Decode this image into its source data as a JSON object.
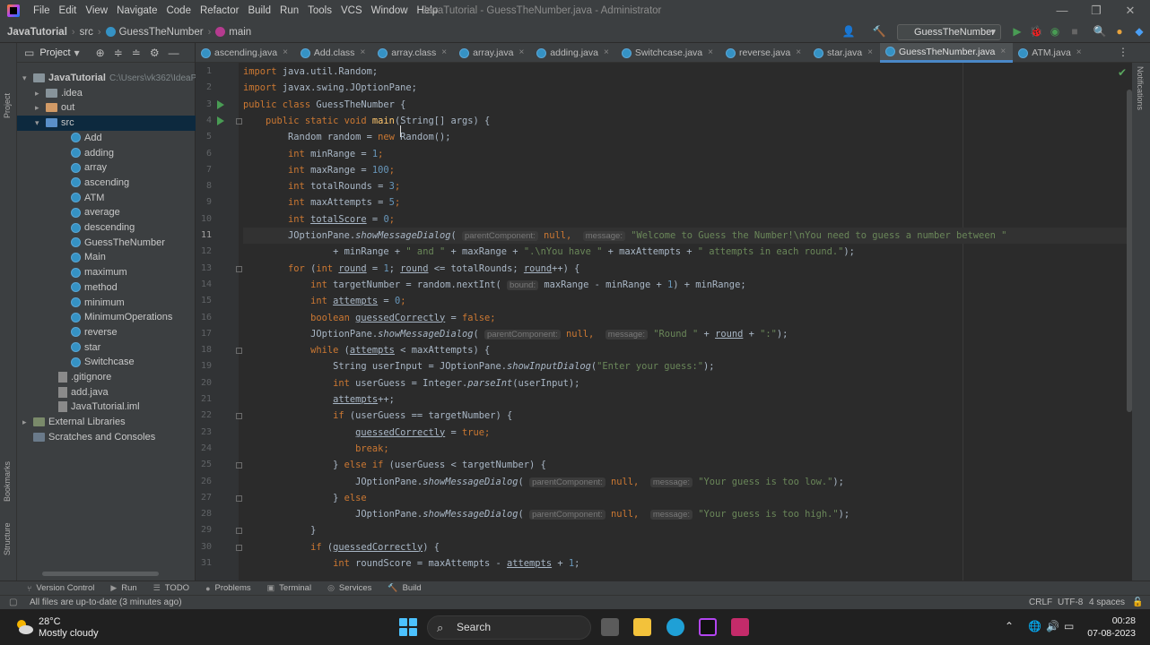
{
  "titlebar": {
    "menu": [
      "File",
      "Edit",
      "View",
      "Navigate",
      "Code",
      "Refactor",
      "Build",
      "Run",
      "Tools",
      "VCS",
      "Window",
      "Help"
    ],
    "title": "JavaTutorial - GuessTheNumber.java - Administrator"
  },
  "navbar": {
    "breadcrumb": [
      "JavaTutorial",
      "src",
      "GuessTheNumber",
      "main"
    ],
    "run_config": "GuessTheNumber"
  },
  "left_stripe": {
    "project": "Project",
    "bookmarks": "Bookmarks",
    "structure": "Structure"
  },
  "right_stripe": {
    "notifications": "Notifications"
  },
  "project_panel": {
    "title": "Project",
    "tree": [
      {
        "label": "JavaTutorial",
        "sub": "C:\\Users\\vk362\\IdeaPro",
        "indent": 0,
        "arrow": "▾",
        "icon": "folder"
      },
      {
        "label": ".idea",
        "indent": 1,
        "arrow": "▸",
        "icon": "folder"
      },
      {
        "label": "out",
        "indent": 1,
        "arrow": "▸",
        "icon": "folder-orange"
      },
      {
        "label": "src",
        "indent": 1,
        "arrow": "▾",
        "icon": "folder-blue",
        "selected": true
      },
      {
        "label": "Add",
        "indent": 3,
        "icon": "class"
      },
      {
        "label": "adding",
        "indent": 3,
        "icon": "class"
      },
      {
        "label": "array",
        "indent": 3,
        "icon": "class"
      },
      {
        "label": "ascending",
        "indent": 3,
        "icon": "class"
      },
      {
        "label": "ATM",
        "indent": 3,
        "icon": "class"
      },
      {
        "label": "average",
        "indent": 3,
        "icon": "class"
      },
      {
        "label": "descending",
        "indent": 3,
        "icon": "class"
      },
      {
        "label": "GuessTheNumber",
        "indent": 3,
        "icon": "class"
      },
      {
        "label": "Main",
        "indent": 3,
        "icon": "class"
      },
      {
        "label": "maximum",
        "indent": 3,
        "icon": "class"
      },
      {
        "label": "method",
        "indent": 3,
        "icon": "class"
      },
      {
        "label": "minimum",
        "indent": 3,
        "icon": "class"
      },
      {
        "label": "MinimumOperations",
        "indent": 3,
        "icon": "class"
      },
      {
        "label": "reverse",
        "indent": 3,
        "icon": "class"
      },
      {
        "label": "star",
        "indent": 3,
        "icon": "class"
      },
      {
        "label": "Switchcase",
        "indent": 3,
        "icon": "class"
      },
      {
        "label": ".gitignore",
        "indent": 2,
        "icon": "file"
      },
      {
        "label": "add.java",
        "indent": 2,
        "icon": "file"
      },
      {
        "label": "JavaTutorial.iml",
        "indent": 2,
        "icon": "file"
      },
      {
        "label": "External Libraries",
        "indent": 0,
        "arrow": "▸",
        "icon": "lib"
      },
      {
        "label": "Scratches and Consoles",
        "indent": 0,
        "icon": "scratch"
      }
    ]
  },
  "tabs": [
    {
      "label": "ascending.java",
      "active": false
    },
    {
      "label": "Add.class",
      "active": false
    },
    {
      "label": "array.class",
      "active": false
    },
    {
      "label": "array.java",
      "active": false
    },
    {
      "label": "adding.java",
      "active": false
    },
    {
      "label": "Switchcase.java",
      "active": false
    },
    {
      "label": "reverse.java",
      "active": false
    },
    {
      "label": "star.java",
      "active": false
    },
    {
      "label": "GuessTheNumber.java",
      "active": true
    },
    {
      "label": "ATM.java",
      "active": false
    }
  ],
  "editor": {
    "current_line": 11,
    "lines": [
      "1",
      "2",
      "3",
      "4",
      "5",
      "6",
      "7",
      "8",
      "9",
      "10",
      "11",
      "12",
      "13",
      "14",
      "15",
      "16",
      "17",
      "18",
      "19",
      "20",
      "21",
      "22",
      "23",
      "24",
      "25",
      "26",
      "27",
      "28",
      "29",
      "30",
      "31"
    ],
    "code": {
      "l1_kw": "import",
      "l1_rest": " java.util.Random;",
      "l2_kw": "import",
      "l2_rest": " javax.swing.JOptionPane;",
      "l3_kw": "public class",
      "l3_rest": " GuessTheNumber {",
      "l4_kw": "    public static void",
      "l4_fn": "main",
      "l4_rest": "(String[] args) {",
      "l5_a": "        Random random = ",
      "l5_kw": "new",
      "l5_b": " Random();",
      "l6_kw": "        int",
      "l6_a": " minRange = ",
      "l6_num": "1",
      "l6_b": ";",
      "l7_kw": "        int",
      "l7_a": " maxRange = ",
      "l7_num": "100",
      "l7_b": ";",
      "l8_kw": "        int",
      "l8_a": " totalRounds = ",
      "l8_num": "3",
      "l8_b": ";",
      "l9_kw": "        int",
      "l9_a": " maxAttempts = ",
      "l9_num": "5",
      "l9_b": ";",
      "l10_kw": "        int",
      "l10_a": " ",
      "l10_ul": "totalScore",
      "l10_b": " = ",
      "l10_num": "0",
      "l10_c": ";",
      "l11_a": "        JOptionPane.",
      "l11_it": "showMessageDialog",
      "l11_b": "( ",
      "l11_h1": "parentComponent:",
      "l11_kw": " null",
      "l11_c": ",  ",
      "l11_h2": "message:",
      "l11_str": " \"Welcome to Guess the Number!\\nYou need to guess a number between \"",
      "l12_a": "                + minRange + ",
      "l12_s1": "\" and \"",
      "l12_b": " + maxRange + ",
      "l12_s2": "\".\\nYou have \"",
      "l12_c": " + maxAttempts + ",
      "l12_s3": "\" attempts in each round.\"",
      "l12_d": ");",
      "l13_kw": "        for",
      "l13_a": " (",
      "l13_kw2": "int",
      "l13_b": " ",
      "l13_u1": "round",
      "l13_c": " = ",
      "l13_num": "1",
      "l13_d": "; ",
      "l13_u2": "round",
      "l13_e": " <= totalRounds; ",
      "l13_u3": "round",
      "l13_f": "++) {",
      "l14_kw": "            int",
      "l14_a": " targetNumber = random.nextInt( ",
      "l14_h": "bound:",
      "l14_b": " maxRange - minRange + ",
      "l14_num": "1",
      "l14_c": ") + minRange;",
      "l15_kw": "            int",
      "l15_a": " ",
      "l15_ul": "attempts",
      "l15_b": " = ",
      "l15_num": "0",
      "l15_c": ";",
      "l16_kw": "            boolean",
      "l16_a": " ",
      "l16_ul": "guessedCorrectly",
      "l16_b": " = ",
      "l16_kw2": "false",
      "l16_c": ";",
      "l17_a": "            JOptionPane.",
      "l17_it": "showMessageDialog",
      "l17_b": "( ",
      "l17_h1": "parentComponent:",
      "l17_kw": " null",
      "l17_c": ",  ",
      "l17_h2": "message:",
      "l17_str": " \"Round \"",
      "l17_d": " + ",
      "l17_ul": "round",
      "l17_e": " + ",
      "l17_str2": "\":\"",
      "l17_f": ");",
      "l18_kw": "            while",
      "l18_a": " (",
      "l18_ul": "attempts",
      "l18_b": " < maxAttempts) {",
      "l19_a": "                String userInput = JOptionPane.",
      "l19_it": "showInputDialog",
      "l19_b": "(",
      "l19_str": "\"Enter your guess:\"",
      "l19_c": ");",
      "l20_kw": "                int",
      "l20_a": " userGuess = Integer.",
      "l20_it": "parseInt",
      "l20_b": "(userInput);",
      "l21_a": "                ",
      "l21_ul": "attempts",
      "l21_b": "++;",
      "l22_kw": "                if",
      "l22_a": " (userGuess == targetNumber) {",
      "l23_a": "                    ",
      "l23_ul": "guessedCorrectly",
      "l23_b": " = ",
      "l23_kw": "true",
      "l23_c": ";",
      "l24_kw": "                    break",
      "l24_a": ";",
      "l25_a": "                } ",
      "l25_kw": "else if",
      "l25_b": " (userGuess < targetNumber) {",
      "l26_a": "                    JOptionPane.",
      "l26_it": "showMessageDialog",
      "l26_b": "( ",
      "l26_h1": "parentComponent:",
      "l26_kw": " null",
      "l26_c": ",  ",
      "l26_h2": "message:",
      "l26_str": " \"Your guess is too low.\"",
      "l26_d": ");",
      "l27_a": "                } ",
      "l27_kw": "else",
      "l28_a": "                    JOptionPane.",
      "l28_it": "showMessageDialog",
      "l28_b": "( ",
      "l28_h1": "parentComponent:",
      "l28_kw": " null",
      "l28_c": ",  ",
      "l28_h2": "message:",
      "l28_str": " \"Your guess is too high.\"",
      "l28_d": ");",
      "l29_a": "            }",
      "l30_kw": "            if",
      "l30_a": " (",
      "l30_ul": "guessedCorrectly",
      "l30_b": ") {",
      "l31_kw": "                int",
      "l31_a": " roundScore = maxAttempts - ",
      "l31_ul": "attempts",
      "l31_b": " + ",
      "l31_num": "1",
      "l31_c": ";"
    }
  },
  "bottom_tools": [
    "Version Control",
    "Run",
    "TODO",
    "Problems",
    "Terminal",
    "Services",
    "Build"
  ],
  "status": {
    "message": "All files are up-to-date (3 minutes ago)",
    "line_sep": "CRLF",
    "encoding": "UTF-8",
    "indent": "4 spaces"
  },
  "taskbar": {
    "temp": "28°C",
    "weather": "Mostly cloudy",
    "search": "Search",
    "time": "00:28",
    "date": "07-08-2023"
  }
}
